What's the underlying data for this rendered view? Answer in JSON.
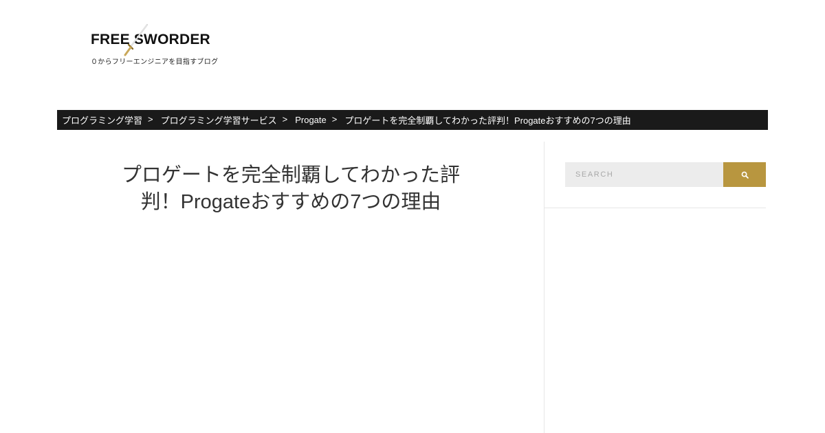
{
  "logo": {
    "title": "FREE SWORDER",
    "tagline": "０からフリーエンジニアを目指すブログ"
  },
  "breadcrumb": {
    "items": [
      "プログラミング学習",
      "プログラミング学習サービス",
      "Progate"
    ],
    "separator": ">",
    "current": "プロゲートを完全制覇してわかった評判！Progateおすすめの7つの理由"
  },
  "post": {
    "title": "プロゲートを完全制覇してわかった評判！Progateおすすめの7つの理由"
  },
  "search": {
    "placeholder": "SEARCH",
    "icon": "search-icon"
  },
  "colors": {
    "breadcrumb_bg": "#1a1a1a",
    "accent": "#b8963f",
    "search_bg": "#ececec",
    "divider": "#e6e6e6"
  }
}
